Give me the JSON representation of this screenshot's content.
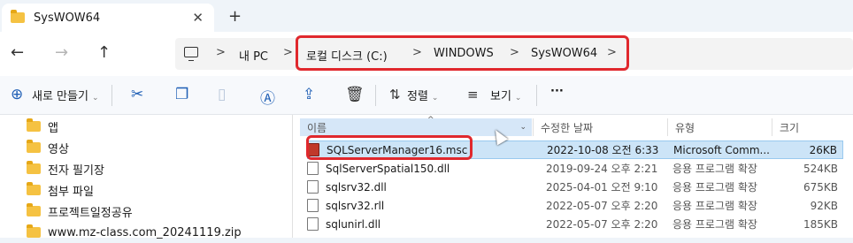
{
  "tab": {
    "title": "SysWOW64",
    "close": "✕",
    "new": "+"
  },
  "nav": {
    "back": "←",
    "forward": "→",
    "up": "↑"
  },
  "breadcrumb": {
    "pc": "내 PC",
    "drive": "로컬 디스크 (C:)",
    "windows": "WINDOWS",
    "current": "SysWOW64",
    "sep": ">"
  },
  "toolbar": {
    "new_label": "새로 만들기",
    "sort_label": "정렬",
    "view_label": "보기",
    "more": "···"
  },
  "sidebar": {
    "items": [
      {
        "label": "앱"
      },
      {
        "label": "영상"
      },
      {
        "label": "전자 필기장"
      },
      {
        "label": "첨부 파일"
      },
      {
        "label": "프로젝트일정공유"
      },
      {
        "label": "www.mz-class.com_20241119.zip"
      }
    ]
  },
  "columns": {
    "name": "이름",
    "date": "수정한 날짜",
    "type": "유형",
    "size": "크기"
  },
  "files": [
    {
      "name": "SQLServerManager16.msc",
      "date": "2022-10-08 오전 6:33",
      "type": "Microsoft Comm...",
      "size": "26KB"
    },
    {
      "name": "SqlServerSpatial150.dll",
      "date": "2019-09-24 오후 2:21",
      "type": "응용 프로그램 확장",
      "size": "524KB"
    },
    {
      "name": "sqlsrv32.dll",
      "date": "2025-04-01 오전 9:10",
      "type": "응용 프로그램 확장",
      "size": "675KB"
    },
    {
      "name": "sqlsrv32.rll",
      "date": "2022-05-07 오후 2:20",
      "type": "응용 프로그램 확장",
      "size": "92KB"
    },
    {
      "name": "sqlunirl.dll",
      "date": "2022-05-07 오후 2:20",
      "type": "응용 프로그램 확장",
      "size": "185KB"
    }
  ],
  "colors": {
    "highlight": "#e0282d",
    "selection": "#cce4f7",
    "accent": "#1f5fb5"
  }
}
